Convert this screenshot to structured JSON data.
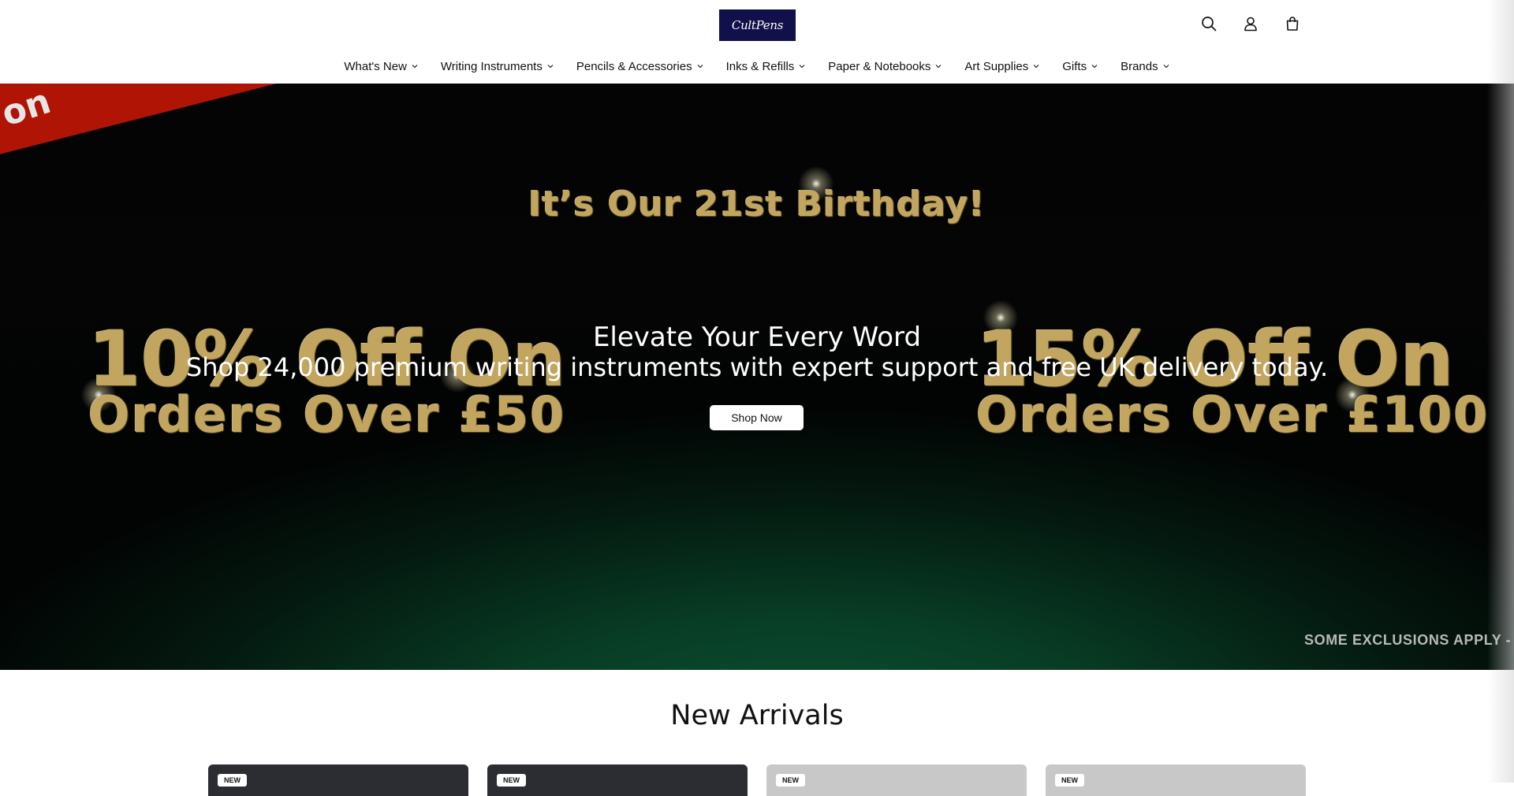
{
  "header": {
    "logo_text": "CultPens",
    "icons": [
      "search-icon",
      "account-icon",
      "cart-icon"
    ]
  },
  "nav": {
    "items": [
      {
        "label": "What's New"
      },
      {
        "label": "Writing Instruments"
      },
      {
        "label": "Pencils & Accessories"
      },
      {
        "label": "Inks & Refills"
      },
      {
        "label": "Paper & Notebooks"
      },
      {
        "label": "Art Supplies"
      },
      {
        "label": "Gifts"
      },
      {
        "label": "Brands"
      }
    ]
  },
  "hero": {
    "ribbon_text": "on",
    "banner_heading": "It’s Our 21st Birthday!",
    "left_promo_line1": "10% Off On",
    "left_promo_line2": "Orders Over £50",
    "right_promo_line1": "15% Off On",
    "right_promo_line2": "Orders Over £100",
    "title": "Elevate Your Every Word",
    "subtitle": "Shop 24,000 premium writing instruments with expert support and free UK delivery today.",
    "cta_label": "Shop Now",
    "exclusions": "SOME EXCLUSIONS APPLY -"
  },
  "new_arrivals": {
    "title": "New Arrivals",
    "cards": [
      {
        "badge": "NEW"
      },
      {
        "badge": "NEW"
      },
      {
        "badge": "NEW"
      },
      {
        "badge": "NEW"
      }
    ]
  },
  "colors": {
    "logo_bg": "#12104a",
    "ribbon": "#b01404",
    "glitter_gold": "#c2a660",
    "hero_green": "#0a5232"
  }
}
